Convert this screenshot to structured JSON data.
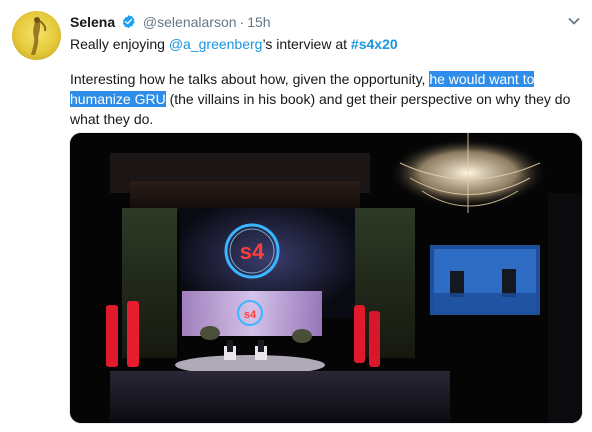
{
  "tweet": {
    "author_name": "Selena",
    "handle": "@selenalarson",
    "separator": "·",
    "time": "15h",
    "line1": {
      "prefix": "Really enjoying ",
      "mention": "@a_greenberg",
      "middle": "’s interview at ",
      "hashtag": "#s4x20"
    },
    "body": {
      "part1": "Interesting how he talks about how, given the opportunity, ",
      "highlight_a": "he would want to",
      "highlight_b": "humanize GRU",
      "part2": " (the villains in his book) and get their perspective on why they do what they do."
    },
    "icons": {
      "verified": "verified-badge-icon",
      "menu": "chevron-down-icon"
    },
    "colors": {
      "link": "#1b95e0",
      "highlight": "#2e8de8",
      "verified": "#1da1f2"
    },
    "media": {
      "stage_logo_text": "s4"
    }
  }
}
